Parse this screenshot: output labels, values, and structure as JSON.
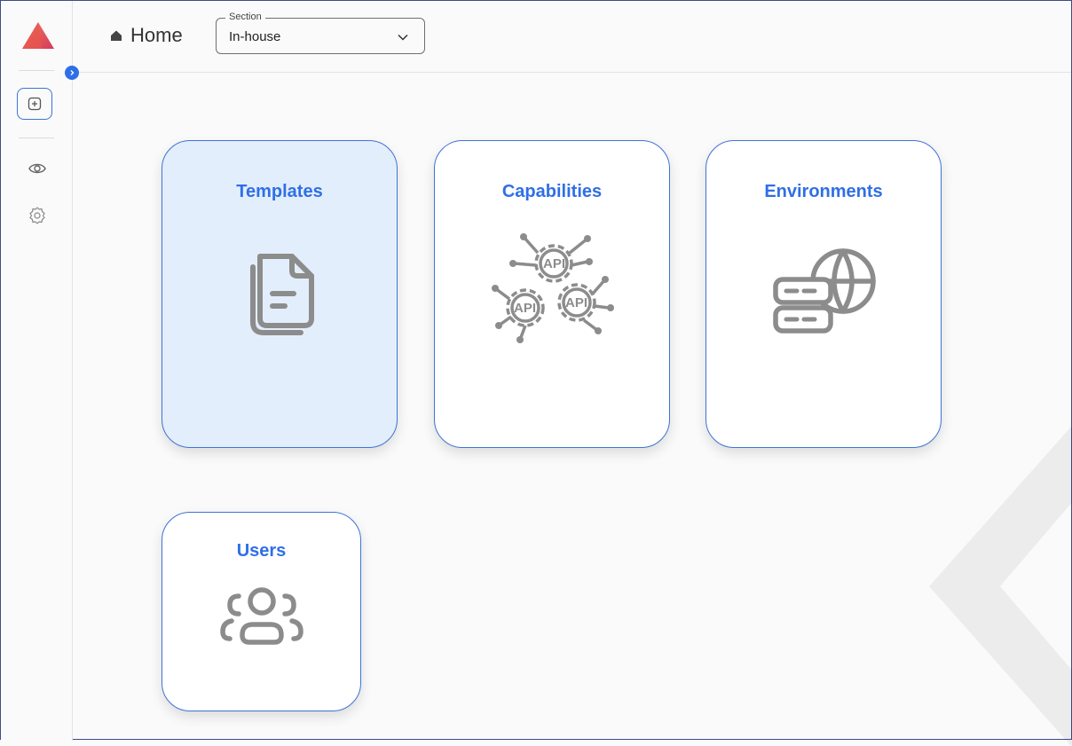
{
  "header": {
    "home_label": "Home",
    "section": {
      "legend": "Section",
      "value": "In-house"
    }
  },
  "sidebar": {
    "items": [
      {
        "name": "add-icon"
      },
      {
        "name": "eye-icon"
      },
      {
        "name": "settings-icon"
      }
    ]
  },
  "cards": [
    {
      "title": "Templates",
      "icon": "documents-icon",
      "active": true
    },
    {
      "title": "Capabilities",
      "icon": "api-gears-icon",
      "active": false
    },
    {
      "title": "Environments",
      "icon": "server-globe-icon",
      "active": false
    },
    {
      "title": "Users",
      "icon": "users-icon",
      "active": false
    }
  ],
  "colors": {
    "accent": "#2f6fe6",
    "card_active_bg": "#e3eefc",
    "icon_gray": "#8c8c8c"
  }
}
